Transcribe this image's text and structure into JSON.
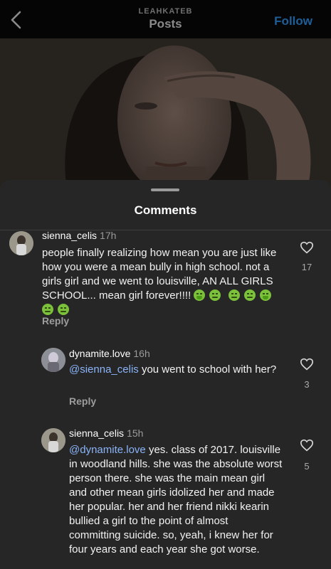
{
  "header": {
    "username": "LEAHKATEB",
    "title": "Posts",
    "follow_label": "Follow"
  },
  "sheet": {
    "title": "Comments"
  },
  "comments": [
    {
      "username": "sienna_celis",
      "time": "17h",
      "text": "people finally realizing how mean you are just like how you were a mean bully in high school. not a girls girl and we went to louisville, AN ALL GIRLS SCHOOL... mean girl forever!!!!",
      "emojis": [
        "nauseated-face-icon",
        "nauseated-face-icon",
        "nauseated-face-icon",
        "nauseated-face-icon",
        "vomiting-face-icon",
        "nauseated-face-icon",
        "nauseated-face-icon"
      ],
      "reply_label": "Reply",
      "likes": "17"
    },
    {
      "username": "dynamite.love",
      "time": "16h",
      "mention": "@sienna_celis",
      "text": " you went to school with her?",
      "reply_label": "Reply",
      "likes": "3"
    },
    {
      "username": "sienna_celis",
      "time": "15h",
      "mention": "@dynamite.love",
      "text": " yes. class of 2017. louisville in woodland hills. she was the absolute worst person there. she was the main mean girl and other mean girls idolized her and made her popular. her and her friend nikki kearin bullied a girl to the point of almost committing suicide. so, yeah, i knew her for four years and each year she got worse.",
      "likes": "5"
    }
  ],
  "colors": {
    "follow": "#1e5f99",
    "mention": "#8ab4f8",
    "sheet_bg": "#262627"
  }
}
